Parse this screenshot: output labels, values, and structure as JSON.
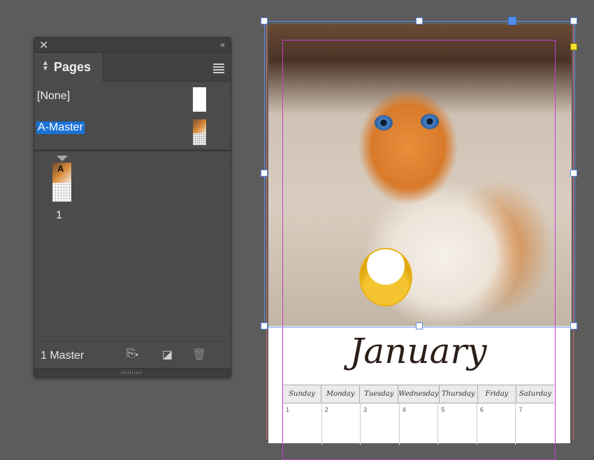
{
  "panel": {
    "tab_label": "Pages",
    "masters": [
      {
        "label": "[None]"
      },
      {
        "label": "A-Master"
      }
    ],
    "page_master_letter": "A",
    "page_number": "1",
    "footer": {
      "label": "1 Master"
    },
    "icons": [
      "close-icon",
      "collapse-icon",
      "panel-menu-icon",
      "edit-page-size-icon",
      "new-page-icon",
      "delete-page-icon"
    ]
  },
  "document": {
    "month": "January",
    "weekdays": [
      "Sunday",
      "Monday",
      "Tuesday",
      "Wednesday",
      "Thursday",
      "Friday",
      "Saturday"
    ],
    "first_week": [
      "1",
      "2",
      "3",
      "4",
      "5",
      "6",
      "7"
    ]
  },
  "colors": {
    "selection": "#5a8ee8",
    "margin_guide": "#c040d0",
    "selected_master": "#1b72d6"
  }
}
